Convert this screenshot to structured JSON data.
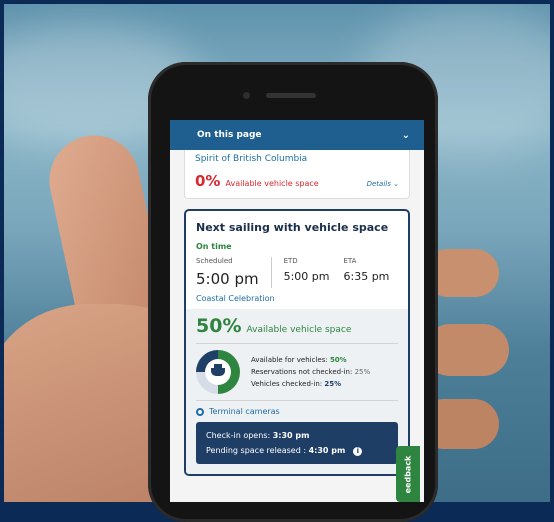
{
  "topbar": {
    "label": "On this page",
    "chevron": "chevron-down-icon"
  },
  "current_sailing": {
    "vessel": "Spirit of British Columbia",
    "percent": "0%",
    "availability_label": "Available vehicle space",
    "details_label": "Details"
  },
  "next_sailing": {
    "title": "Next sailing with vehicle space",
    "status": "On time",
    "scheduled_label": "Scheduled",
    "scheduled_time": "5:00 pm",
    "etd_label": "ETD",
    "etd_time": "5:00 pm",
    "eta_label": "ETA",
    "eta_time": "6:35 pm",
    "vessel": "Coastal Celebration",
    "percent": "50%",
    "availability_label": "Available vehicle space",
    "breakdown": {
      "available_label": "Available for vehicles:",
      "available_value": "50%",
      "reservations_label": "Reservations not checked-in:",
      "reservations_value": "25%",
      "checked_label": "Vehicles checked-in:",
      "checked_value": "25%"
    },
    "terminal_cameras": "Terminal cameras",
    "checkin_label": "Check-in opens:",
    "checkin_time": "3:30 pm",
    "pending_label": "Pending space released :",
    "pending_time": "4:30 pm"
  },
  "feedback": "eedback",
  "colors": {
    "primary": "#1f3e66",
    "green": "#2e8540",
    "red": "#d8292f",
    "link": "#1e6ea6"
  }
}
